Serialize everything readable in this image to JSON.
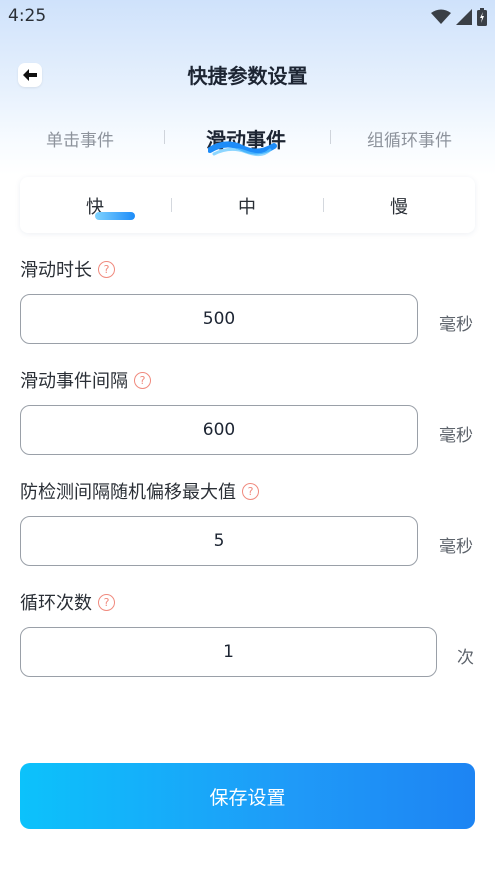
{
  "status_bar": {
    "time": "4:25",
    "icons": [
      "wifi-icon",
      "cellular-signal-icon",
      "battery-icon"
    ]
  },
  "header": {
    "back_icon": "back-arrow-icon",
    "title": "快捷参数设置"
  },
  "top_tabs": [
    {
      "label": "单击事件",
      "active": false
    },
    {
      "label": "滑动事件",
      "active": true
    },
    {
      "label": "组循环事件",
      "active": false
    }
  ],
  "speed_options": [
    {
      "label": "快",
      "active": true
    },
    {
      "label": "中",
      "active": false
    },
    {
      "label": "慢",
      "active": false
    }
  ],
  "fields": [
    {
      "label": "滑动时长",
      "value": "500",
      "unit": "毫秒"
    },
    {
      "label": "滑动事件间隔",
      "value": "600",
      "unit": "毫秒"
    },
    {
      "label": "防检测间隔随机偏移最大值",
      "value": "5",
      "unit": "毫秒"
    },
    {
      "label": "循环次数",
      "value": "1",
      "unit": "次"
    }
  ],
  "help_icon_glyph": "?",
  "save_button": {
    "label": "保存设置"
  },
  "colors": {
    "accent": "#1d8cf8",
    "accent_light": "#0cc2fb",
    "help_icon": "#f08a7e",
    "title": "#1d2533"
  }
}
